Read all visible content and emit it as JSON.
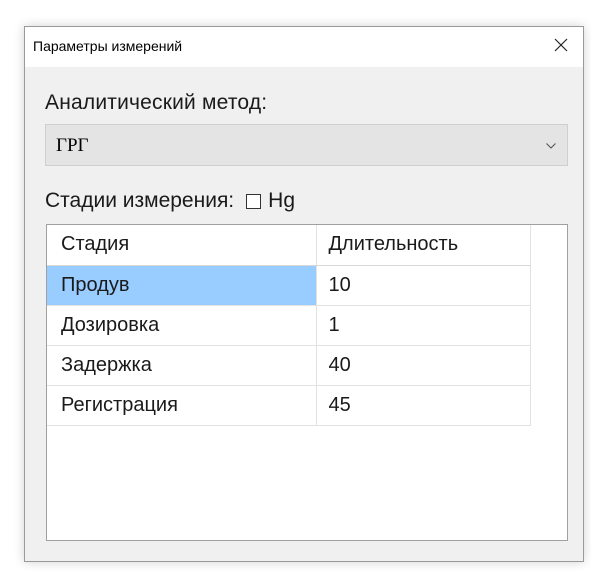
{
  "window": {
    "title": "Параметры измерений"
  },
  "method": {
    "label": "Аналитический метод:",
    "selected": "ГРГ"
  },
  "stages": {
    "label": "Стадии измерения:",
    "checkbox_label": "Hg",
    "checkbox_checked": false
  },
  "table": {
    "headers": [
      "Стадия",
      "Длительность"
    ],
    "rows": [
      {
        "stage": "Продув",
        "duration": "10"
      },
      {
        "stage": "Дозировка",
        "duration": "1"
      },
      {
        "stage": "Задержка",
        "duration": "40"
      },
      {
        "stage": "Регистрация",
        "duration": "45"
      }
    ]
  },
  "colors": {
    "selection": "#99ccff",
    "dialog_background": "#f0f0f0"
  },
  "icons": {
    "close": "close-icon",
    "dropdown": "chevron-down-icon"
  }
}
